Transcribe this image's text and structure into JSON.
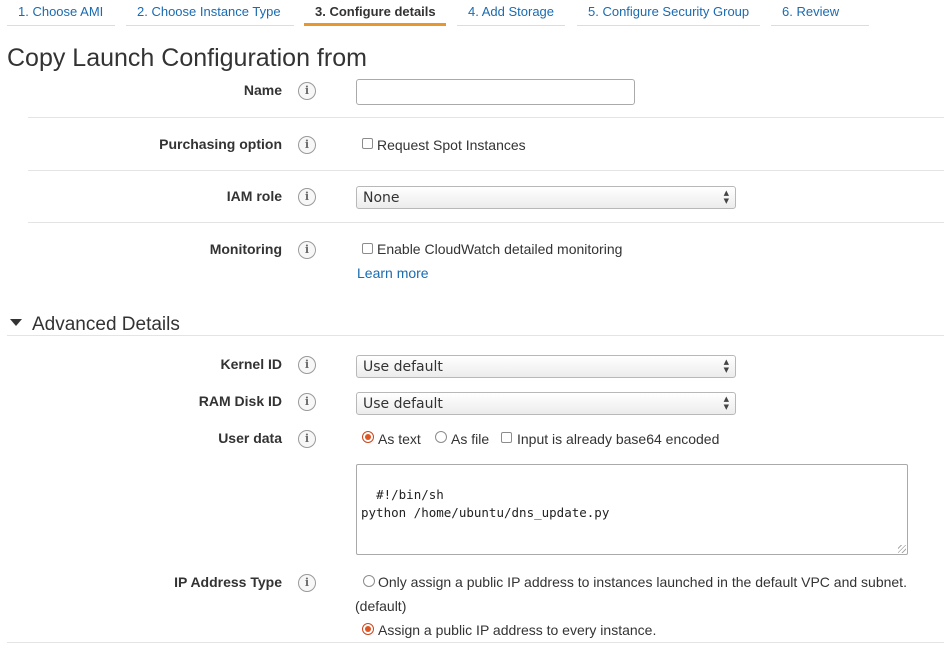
{
  "tabs": [
    {
      "label": "1. Choose AMI"
    },
    {
      "label": "2. Choose Instance Type"
    },
    {
      "label": "3. Configure details"
    },
    {
      "label": "4. Add Storage"
    },
    {
      "label": "5. Configure Security Group"
    },
    {
      "label": "6. Review"
    }
  ],
  "active_tab_index": 2,
  "page_title": "Copy Launch Configuration from",
  "info_icon_glyph": "i",
  "form": {
    "name": {
      "label": "Name",
      "value": ""
    },
    "purchasing": {
      "label": "Purchasing option",
      "checkbox_label": "Request Spot Instances",
      "checked": false
    },
    "iam_role": {
      "label": "IAM role",
      "selected": "None"
    },
    "monitoring": {
      "label": "Monitoring",
      "checkbox_label": "Enable CloudWatch detailed monitoring",
      "checked": false,
      "link": "Learn more"
    }
  },
  "advanced": {
    "heading": "Advanced Details",
    "kernel_id": {
      "label": "Kernel ID",
      "selected": "Use default"
    },
    "ram_disk_id": {
      "label": "RAM Disk ID",
      "selected": "Use default"
    },
    "user_data": {
      "label": "User data",
      "as_text": "As text",
      "as_file": "As file",
      "base64_label": "Input is already base64 encoded",
      "mode_selected": "As text",
      "content": "#!/bin/sh\npython /home/ubuntu/dns_update.py"
    },
    "ip_address_type": {
      "label": "IP Address Type",
      "option_default_line1": "Only assign a public IP address to instances launched in the default VPC and subnet.",
      "option_default_line2": "(default)",
      "option_every": "Assign a public IP address to every instance.",
      "selected": "Assign a public IP address to every instance."
    }
  },
  "colors": {
    "link": "#1a6bb0",
    "active_tab_underline": "#e8962e",
    "radio_selected": "#dd5522"
  }
}
